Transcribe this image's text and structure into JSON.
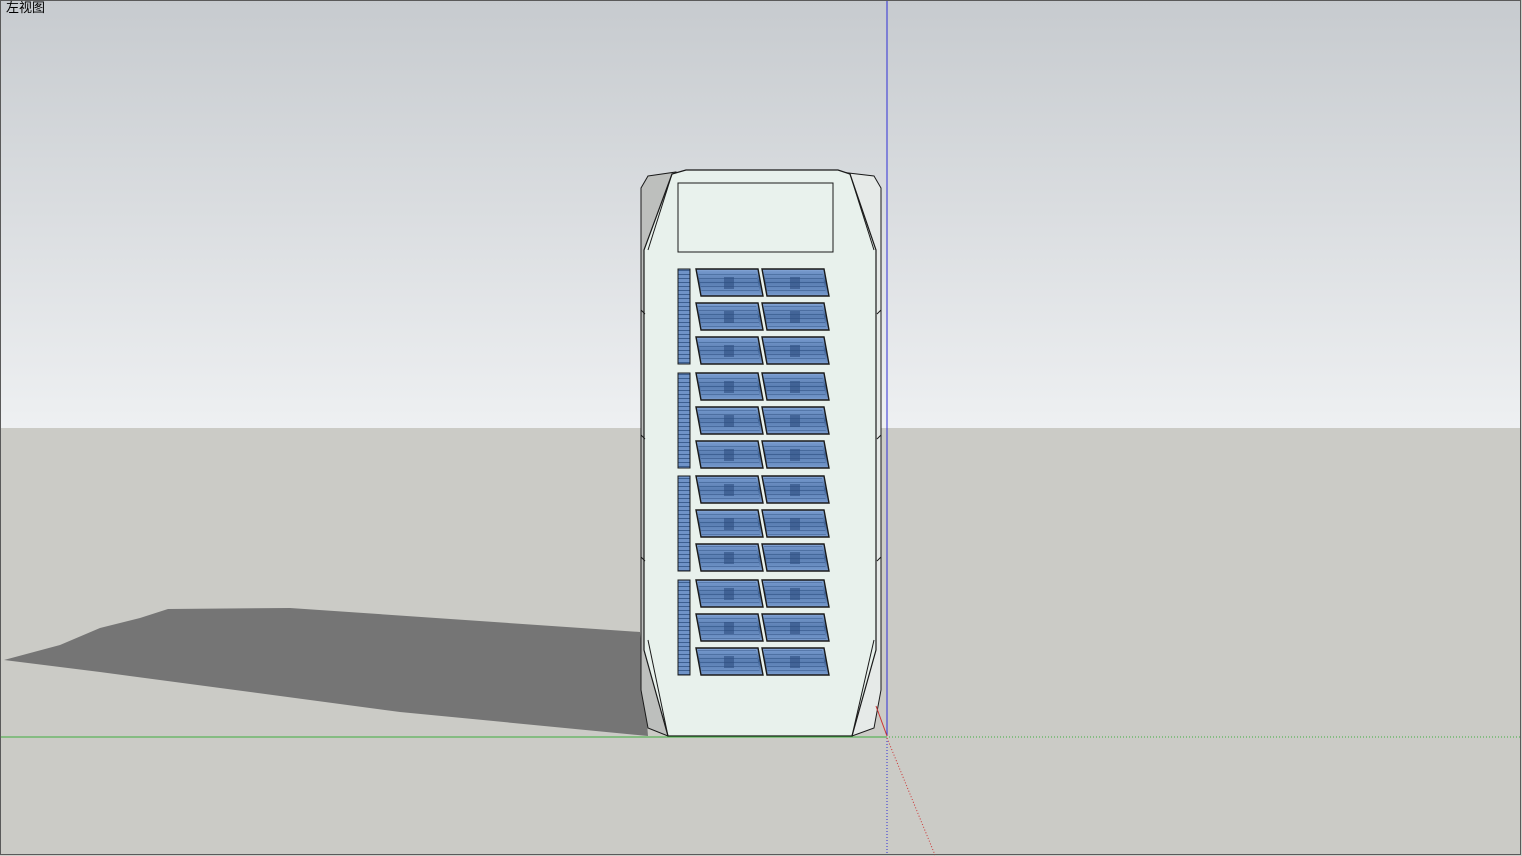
{
  "viewport": {
    "view_name": "左视图",
    "sky_top_color": "#c7cbcf",
    "sky_bottom_color": "#eef0f2",
    "ground_color": "#cbcbc6",
    "shadow_color": "#757575"
  },
  "axes": {
    "blue_axis_color": "#2f2fd6",
    "green_axis_color": "#3fae3f",
    "red_axis_color": "#cc3333"
  },
  "model": {
    "facade_color": "#e8f1ec",
    "side_color": "#bdbfbd",
    "edge_color": "#1a1a1a",
    "panel_color_light": "#7d9fd1",
    "panel_color_dark": "#2e4f80",
    "panel_rows": 12,
    "panel_columns": 2,
    "panel_groups": 4
  }
}
